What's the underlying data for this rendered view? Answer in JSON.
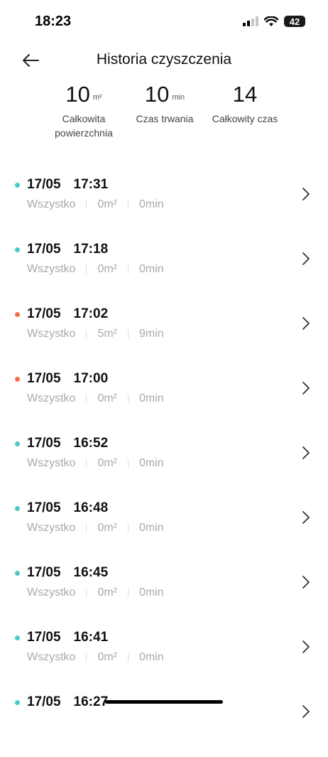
{
  "status_bar": {
    "time": "18:23",
    "battery": "42"
  },
  "header": {
    "title": "Historia czyszczenia"
  },
  "stats": [
    {
      "value": "10",
      "unit": "m²",
      "label": "Całkowita powierzchnia"
    },
    {
      "value": "10",
      "unit": "min",
      "label": "Czas trwania"
    },
    {
      "value": "14",
      "unit": "",
      "label": "Całkowity czas"
    }
  ],
  "history": [
    {
      "date": "17/05",
      "time": "17:31",
      "mode": "Wszystko",
      "area": "0m²",
      "duration": "0min",
      "status_color": "#4cc9c5"
    },
    {
      "date": "17/05",
      "time": "17:18",
      "mode": "Wszystko",
      "area": "0m²",
      "duration": "0min",
      "status_color": "#4cc9c5"
    },
    {
      "date": "17/05",
      "time": "17:02",
      "mode": "Wszystko",
      "area": "5m²",
      "duration": "9min",
      "status_color": "#f0714a"
    },
    {
      "date": "17/05",
      "time": "17:00",
      "mode": "Wszystko",
      "area": "0m²",
      "duration": "0min",
      "status_color": "#f0714a"
    },
    {
      "date": "17/05",
      "time": "16:52",
      "mode": "Wszystko",
      "area": "0m²",
      "duration": "0min",
      "status_color": "#4cc9c5"
    },
    {
      "date": "17/05",
      "time": "16:48",
      "mode": "Wszystko",
      "area": "0m²",
      "duration": "0min",
      "status_color": "#4cc9c5"
    },
    {
      "date": "17/05",
      "time": "16:45",
      "mode": "Wszystko",
      "area": "0m²",
      "duration": "0min",
      "status_color": "#4cc9c5"
    },
    {
      "date": "17/05",
      "time": "16:41",
      "mode": "Wszystko",
      "area": "0m²",
      "duration": "0min",
      "status_color": "#4cc9c5"
    },
    {
      "date": "17/05",
      "time": "16:27",
      "mode": "",
      "area": "",
      "duration": "",
      "status_color": "#4cc9c5"
    }
  ],
  "icons": {
    "back": "arrow-left-icon",
    "chevron": "chevron-right-icon"
  }
}
